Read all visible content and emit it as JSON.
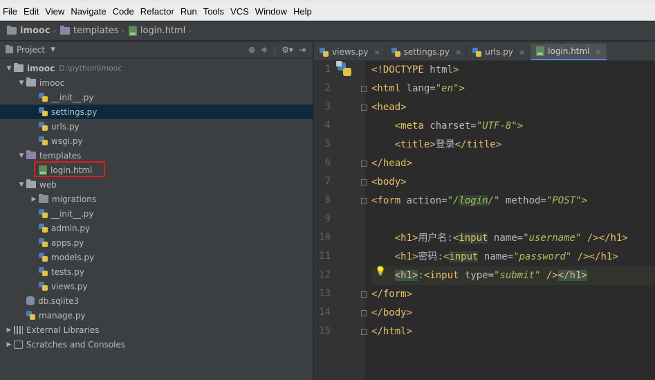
{
  "menu": [
    {
      "label": "File",
      "u": "F"
    },
    {
      "label": "Edit",
      "u": "E"
    },
    {
      "label": "View",
      "u": "V"
    },
    {
      "label": "Navigate",
      "u": "N"
    },
    {
      "label": "Code",
      "u": "C"
    },
    {
      "label": "Refactor",
      "u": "R"
    },
    {
      "label": "Run",
      "u": "u"
    },
    {
      "label": "Tools",
      "u": "T"
    },
    {
      "label": "VCS",
      "u": "S"
    },
    {
      "label": "Window",
      "u": "W"
    },
    {
      "label": "Help",
      "u": "H"
    }
  ],
  "breadcrumb": [
    "imooc",
    "templates",
    "login.html"
  ],
  "project": {
    "title": "Project",
    "tree": [
      {
        "label": "imooc",
        "hint": "D:\\python\\imooc",
        "type": "folder",
        "indent": 0,
        "arrow": "open",
        "bold": true
      },
      {
        "label": "imooc",
        "type": "folder",
        "indent": 1,
        "arrow": "open"
      },
      {
        "label": "__init__.py",
        "type": "py",
        "indent": 2
      },
      {
        "label": "settings.py",
        "type": "py",
        "indent": 2,
        "selected": true
      },
      {
        "label": "urls.py",
        "type": "py",
        "indent": 2
      },
      {
        "label": "wsgi.py",
        "type": "py",
        "indent": 2
      },
      {
        "label": "templates",
        "type": "folder-purple",
        "indent": 1,
        "arrow": "open"
      },
      {
        "label": "login.html",
        "type": "html",
        "indent": 2
      },
      {
        "label": "web",
        "type": "folder",
        "indent": 1,
        "arrow": "open"
      },
      {
        "label": "migrations",
        "type": "folder-dark",
        "indent": 2,
        "arrow": "closed"
      },
      {
        "label": "__init__.py",
        "type": "py",
        "indent": 2
      },
      {
        "label": "admin.py",
        "type": "py",
        "indent": 2
      },
      {
        "label": "apps.py",
        "type": "py",
        "indent": 2
      },
      {
        "label": "models.py",
        "type": "py",
        "indent": 2
      },
      {
        "label": "tests.py",
        "type": "py",
        "indent": 2
      },
      {
        "label": "views.py",
        "type": "py",
        "indent": 2
      },
      {
        "label": "db.sqlite3",
        "type": "db",
        "indent": 1
      },
      {
        "label": "manage.py",
        "type": "py",
        "indent": 1
      },
      {
        "label": "External Libraries",
        "type": "lib",
        "indent": 0,
        "arrow": "closed"
      },
      {
        "label": "Scratches and Consoles",
        "type": "scratch",
        "indent": 0,
        "arrow": "closed"
      }
    ]
  },
  "tabs": [
    {
      "label": "views.py",
      "type": "py"
    },
    {
      "label": "settings.py",
      "type": "py"
    },
    {
      "label": "urls.py",
      "type": "py"
    },
    {
      "label": "login.html",
      "type": "html",
      "active": true
    }
  ],
  "line_numbers": [
    "1",
    "2",
    "3",
    "4",
    "5",
    "6",
    "7",
    "8",
    "9",
    "10",
    "11",
    "12",
    "13",
    "14",
    "15"
  ]
}
